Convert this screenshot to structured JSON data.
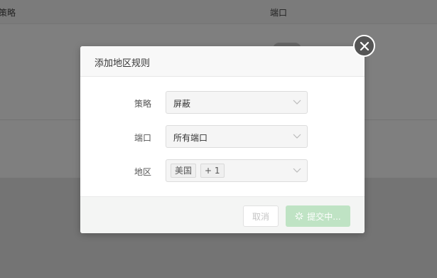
{
  "background": {
    "columns": [
      "策略",
      "端口"
    ]
  },
  "modal": {
    "title": "添加地区规则",
    "close_icon": "close-circle-icon",
    "fields": {
      "strategy": {
        "label": "策略",
        "value": "屏蔽"
      },
      "port": {
        "label": "端口",
        "value": "所有端口"
      },
      "region": {
        "label": "地区",
        "tag": "美国",
        "more": "+ 1"
      }
    },
    "footer": {
      "cancel_label": "取消",
      "submit_label": "提交中..."
    }
  },
  "colors": {
    "overlay": "rgba(0,0,0,0.5)",
    "submit_disabled": "#bfe3c4"
  }
}
